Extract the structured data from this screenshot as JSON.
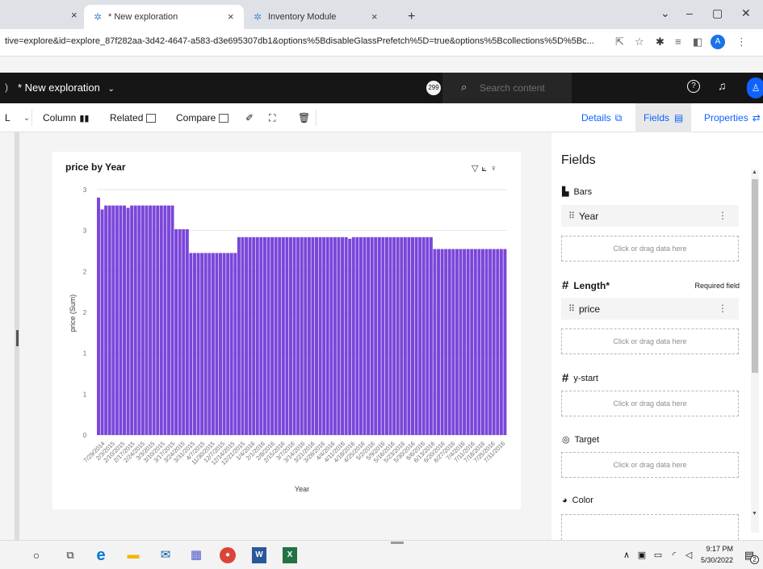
{
  "browser": {
    "tabs": [
      {
        "label": "",
        "active": false
      },
      {
        "label": "* New exploration",
        "active": true
      },
      {
        "label": "Inventory Module",
        "active": false
      }
    ],
    "new_tab": "+",
    "url": "tive=explore&id=explore_87f282aa-3d42-4647-a583-d3e695307db1&options%5BdisableGlassPrefetch%5D=true&options%5Bcollections%5D%5Bc...",
    "profile_initial": "A"
  },
  "app": {
    "title": "* New exploration",
    "notification_count": "299",
    "search_placeholder": "Search content"
  },
  "toolbar": {
    "column": "Column",
    "related": "Related",
    "compare": "Compare",
    "details": "Details",
    "fields": "Fields",
    "properties": "Properties"
  },
  "chart_card": {
    "title": "price by Year",
    "icons": [
      "filter-icon",
      "trend-icon",
      "insight-icon"
    ]
  },
  "chart_data": {
    "type": "bar",
    "title": "price by Year",
    "xlabel": "Year",
    "ylabel": "price (Sum)",
    "y_tick_labels": [
      "0",
      "1",
      "1",
      "2",
      "2",
      "3",
      "3"
    ],
    "ylim": [
      0,
      3.1
    ],
    "bar_color": "#7b46da",
    "x_tick_labels": [
      "7/29/2014",
      "2/3/2015",
      "2/10/2015",
      "2/17/2015",
      "2/24/2015",
      "3/3/2015",
      "3/10/2015",
      "3/17/2015",
      "3/24/2015",
      "3/31/2015",
      "4/7/2015",
      "11/30/2015",
      "12/7/2015",
      "12/14/2015",
      "12/21/2015",
      "1/4/2016",
      "2/1/2016",
      "2/8/2016",
      "2/15/2016",
      "3/7/2016",
      "3/14/2016",
      "3/21/2016",
      "3/28/2016",
      "4/4/2016",
      "4/11/2016",
      "4/18/2016",
      "4/25/2016",
      "5/2/2016",
      "5/9/2016",
      "5/16/2016",
      "5/23/2016",
      "5/30/2016",
      "6/6/2016",
      "6/13/2016",
      "6/20/2016",
      "6/27/2016",
      "7/4/2016",
      "7/11/2016",
      "7/18/2016",
      "7/25/2016",
      "7/31/2016"
    ],
    "segments": [
      {
        "count": 1,
        "value": 3.0
      },
      {
        "count": 1,
        "value": 2.85
      },
      {
        "count": 6,
        "value": 2.9
      },
      {
        "count": 1,
        "value": 2.87
      },
      {
        "count": 12,
        "value": 2.9
      },
      {
        "count": 4,
        "value": 2.6
      },
      {
        "count": 13,
        "value": 2.3
      },
      {
        "count": 30,
        "value": 2.5
      },
      {
        "count": 1,
        "value": 2.48
      },
      {
        "count": 22,
        "value": 2.5
      },
      {
        "count": 20,
        "value": 2.35
      }
    ]
  },
  "panel": {
    "title": "Fields",
    "sections": [
      {
        "label": "Bars",
        "field": "Year",
        "drop": "Click or drag data here"
      },
      {
        "label": "Length*",
        "required": "Required field",
        "field": "price",
        "drop": "Click or drag data here"
      },
      {
        "label": "y-start",
        "drop": "Click or drag data here"
      },
      {
        "label": "Target",
        "drop": "Click or drag data here"
      },
      {
        "label": "Color"
      }
    ]
  },
  "taskbar": {
    "time": "9:17 PM",
    "date": "5/30/2022",
    "notifications": "2"
  }
}
